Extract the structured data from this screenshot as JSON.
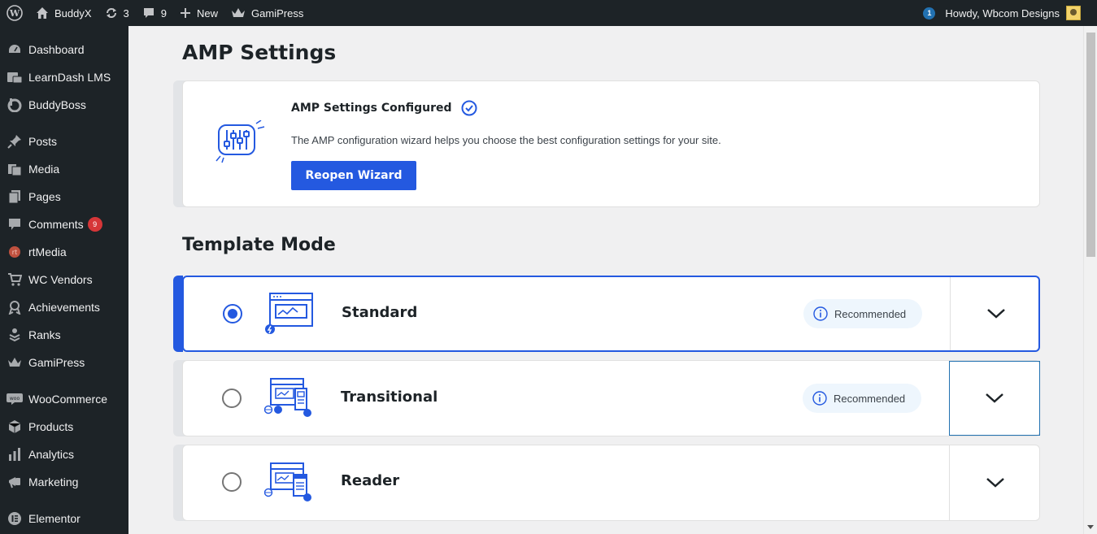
{
  "admin_bar": {
    "site_name": "BuddyX",
    "updates_count": "3",
    "comments_count": "9",
    "new_label": "New",
    "gamipress_label": "GamiPress",
    "notifications_count": "1",
    "greeting": "Howdy, Wbcom Designs"
  },
  "sidebar": {
    "items": [
      {
        "label": "Dashboard",
        "icon": "dashboard-icon"
      },
      {
        "label": "LearnDash LMS",
        "icon": "learndash-icon"
      },
      {
        "label": "BuddyBoss",
        "icon": "buddyboss-icon"
      },
      {
        "label": "Posts",
        "icon": "pin-icon"
      },
      {
        "label": "Media",
        "icon": "media-icon"
      },
      {
        "label": "Pages",
        "icon": "pages-icon"
      },
      {
        "label": "Comments",
        "icon": "comment-icon",
        "count": "9"
      },
      {
        "label": "rtMedia",
        "icon": "rtmedia-icon"
      },
      {
        "label": "WC Vendors",
        "icon": "cart-icon"
      },
      {
        "label": "Achievements",
        "icon": "achievement-icon"
      },
      {
        "label": "Ranks",
        "icon": "ranks-icon"
      },
      {
        "label": "GamiPress",
        "icon": "crown-icon"
      },
      {
        "label": "WooCommerce",
        "icon": "woocommerce-icon"
      },
      {
        "label": "Products",
        "icon": "box-icon"
      },
      {
        "label": "Analytics",
        "icon": "bar-chart-icon"
      },
      {
        "label": "Marketing",
        "icon": "megaphone-icon"
      },
      {
        "label": "Elementor",
        "icon": "elementor-icon"
      }
    ]
  },
  "main": {
    "title": "AMP Settings",
    "wizard": {
      "title": "AMP Settings Configured",
      "description": "The AMP configuration wizard helps you choose the best configuration settings for your site.",
      "button_label": "Reopen Wizard"
    },
    "template_mode": {
      "title": "Template Mode",
      "modes": [
        {
          "label": "Standard",
          "selected": true,
          "badge": "Recommended"
        },
        {
          "label": "Transitional",
          "selected": false,
          "badge": "Recommended"
        },
        {
          "label": "Reader",
          "selected": false,
          "badge": ""
        }
      ]
    }
  },
  "colors": {
    "accent": "#2459e0",
    "admin_bg": "#1d2327",
    "page_bg": "#f0f0f1",
    "badge_bg": "#eef6fd",
    "count_badge": "#d63638"
  }
}
